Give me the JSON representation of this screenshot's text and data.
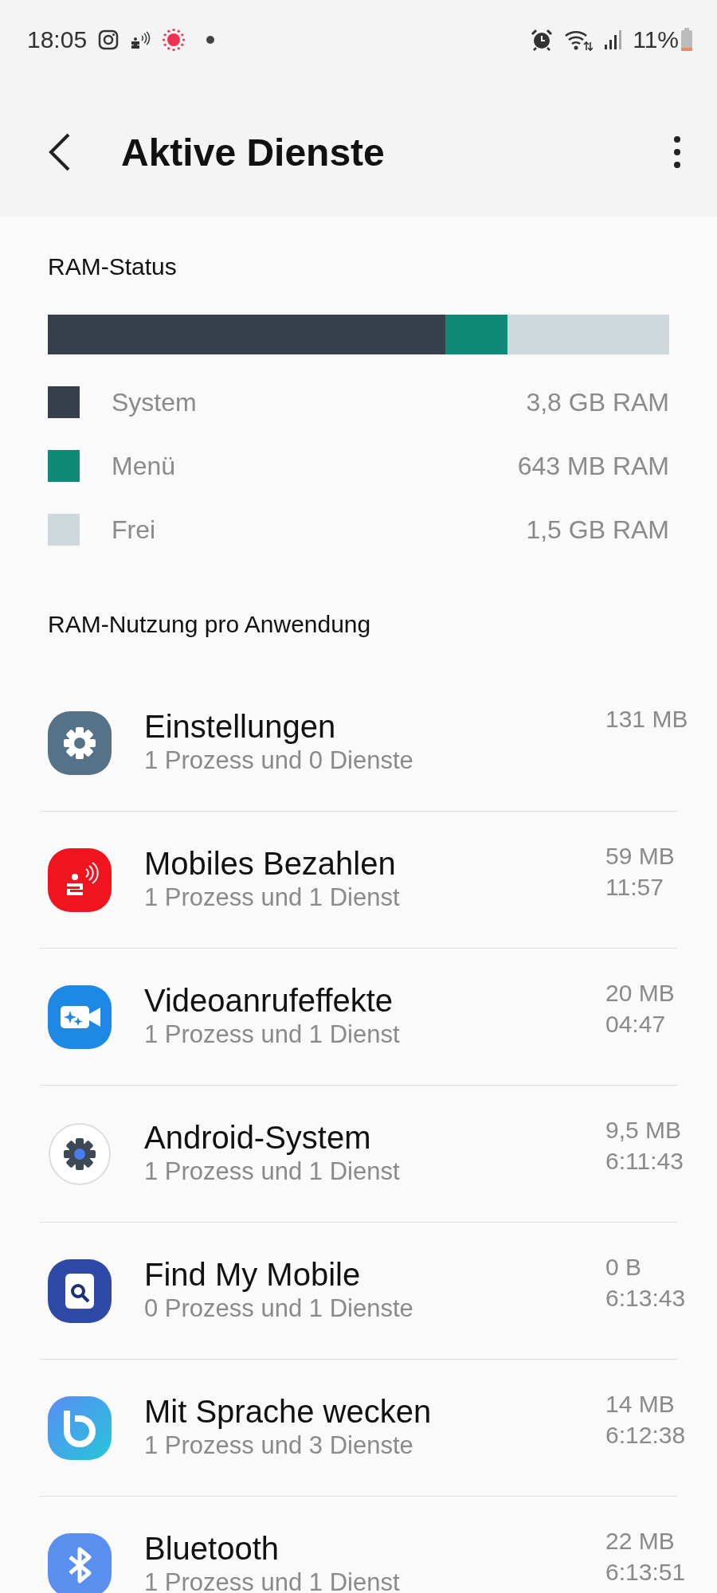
{
  "status_bar": {
    "time": "18:05",
    "battery": "11%"
  },
  "header": {
    "title": "Aktive Dienste"
  },
  "ram_status": {
    "title": "RAM-Status",
    "segments": [
      {
        "label": "System",
        "value": "3,8 GB RAM",
        "color": "#37404a",
        "level": 0.64
      },
      {
        "label": "Menü",
        "value": "643 MB RAM",
        "color": "#0f8a78"
      },
      {
        "label": "Frei",
        "value": "1,5 GB RAM",
        "color": "#cfd8dc",
        "level": 0.26
      }
    ]
  },
  "apps_section": {
    "title": "RAM-Nutzung pro Anwendung",
    "apps": [
      {
        "kind": "settings",
        "name": "Einstellungen",
        "detail": "1 Prozess und 0 Dienste",
        "memory": "131 MB"
      },
      {
        "kind": "payment",
        "name": "Mobiles Bezahlen",
        "detail": "1 Prozess und 1 Dienst",
        "memory": "59 MB",
        "time": "11:57"
      },
      {
        "kind": "video",
        "name": "Videoanrufeffekte",
        "detail": "1 Prozess und 1 Dienst",
        "memory": "20 MB",
        "time": "04:47"
      },
      {
        "kind": "system",
        "name": "Android-System",
        "detail": "1 Prozess und 1 Dienst",
        "memory": "9,5 MB",
        "time": "6:11:43"
      },
      {
        "kind": "find",
        "name": "Find My Mobile",
        "detail": "0 Prozess und 1 Dienste",
        "memory": "0 B",
        "time": "6:13:43"
      },
      {
        "kind": "voice",
        "name": "Mit Sprache wecken",
        "detail": "1 Prozess und 3 Dienste",
        "memory": "14 MB",
        "time": "6:12:38"
      },
      {
        "kind": "bluetooth",
        "name": "Bluetooth",
        "detail": "1 Prozess und 1 Dienst",
        "memory": "22 MB",
        "time": "6:13:51"
      }
    ]
  }
}
